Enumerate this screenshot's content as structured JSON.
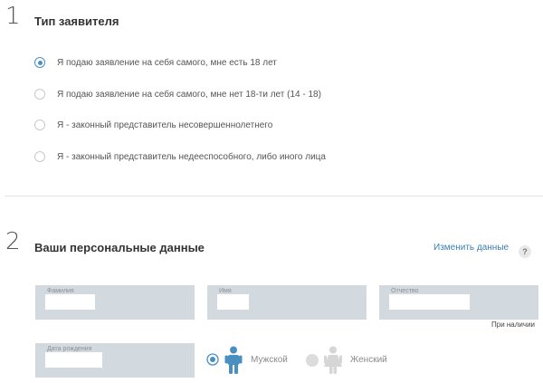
{
  "section1": {
    "number": "1",
    "title": "Тип заявителя",
    "options": [
      {
        "label": "Я подаю заявление на себя самого, мне есть 18 лет",
        "selected": true
      },
      {
        "label": "Я подаю заявление на себя самого, мне нет 18-ти лет (14 - 18)",
        "selected": false
      },
      {
        "label": "Я - законный представитель несовершеннолетнего",
        "selected": false
      },
      {
        "label": "Я - законный представитель недееспособного, либо иного лица",
        "selected": false
      }
    ]
  },
  "section2": {
    "number": "2",
    "title": "Ваши персональные данные",
    "change_link": "Изменить данные",
    "help": "?",
    "fields": {
      "lastname_label": "Фамилия",
      "firstname_label": "Имя",
      "patronymic_label": "Отчество",
      "patronymic_hint": "При наличии",
      "birthdate_label": "Дата рождения"
    },
    "gender": {
      "male_label": "Мужской",
      "female_label": "Женский",
      "selected": "male"
    }
  },
  "colors": {
    "accent": "#4a8fc1",
    "link": "#3b7fb5",
    "field_bg": "#d3dadf",
    "divider": "#e3e3e3"
  }
}
